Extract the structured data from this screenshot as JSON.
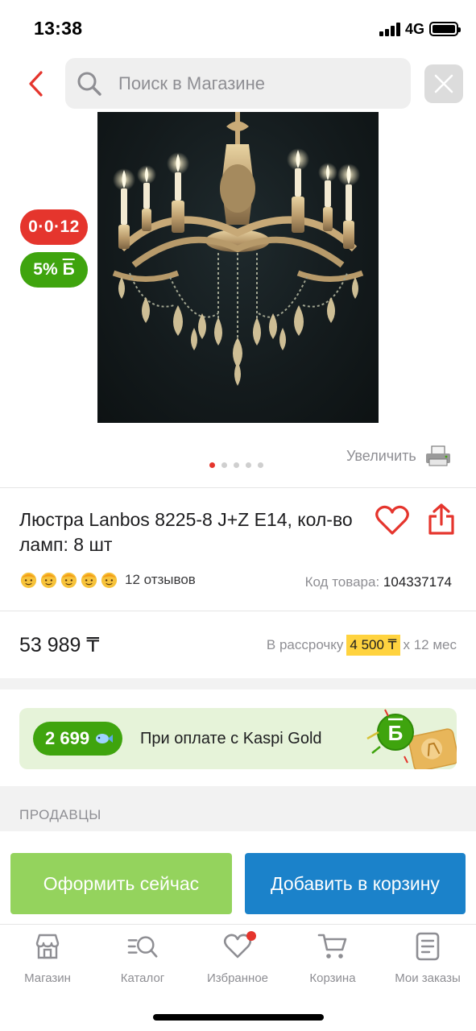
{
  "status_bar": {
    "time": "13:38",
    "network": "4G"
  },
  "search": {
    "placeholder": "Поиск в Магазине"
  },
  "badges": {
    "installment": "0·0·12",
    "bonus_percent": "5%",
    "bonus_symbol": "Б"
  },
  "gallery": {
    "image_count": 5,
    "active_index": 0,
    "zoom_label": "Увеличить"
  },
  "product": {
    "title": "Люстра Lanbos 8225-8 J+Z E14, кол-во ламп: 8 шт",
    "rating": 5,
    "reviews": "12 отзывов",
    "code_label": "Код товара:",
    "code_value": "104337174",
    "price": "53 989 ₸",
    "installment_prefix": "В рассрочку",
    "installment_amount": "4 500 ₸",
    "installment_suffix": "x 12 мес"
  },
  "kaspi_gold": {
    "bonus": "2 699",
    "text": "При оплате с Kaspi Gold",
    "symbol": "Б"
  },
  "sellers": {
    "title": "ПРОДАВЦЫ"
  },
  "actions": {
    "checkout": "Оформить сейчас",
    "add_to_cart": "Добавить в корзину"
  },
  "tabs": [
    {
      "label": "Магазин",
      "icon": "store-icon"
    },
    {
      "label": "Каталог",
      "icon": "catalog-icon"
    },
    {
      "label": "Избранное",
      "icon": "heart-icon",
      "has_notification": true
    },
    {
      "label": "Корзина",
      "icon": "cart-icon"
    },
    {
      "label": "Мои заказы",
      "icon": "orders-icon"
    }
  ],
  "colors": {
    "accent_red": "#e5352d",
    "green": "#3fa40e",
    "light_green": "#94d35d",
    "blue": "#1b82ca",
    "yellow": "#ffd33f"
  }
}
